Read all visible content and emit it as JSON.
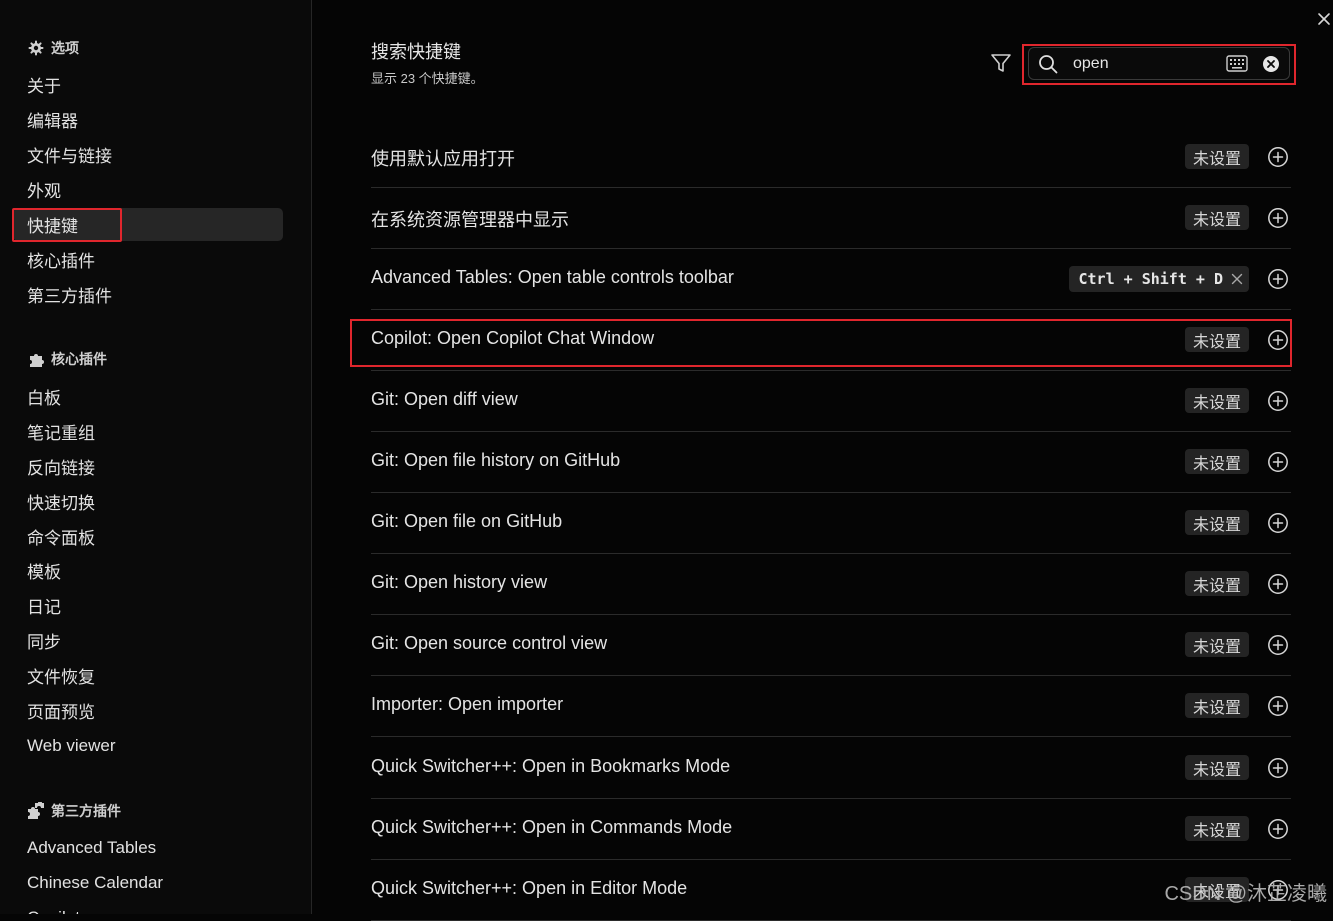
{
  "sidebar": {
    "options_header": "选项",
    "options_items": [
      "关于",
      "编辑器",
      "文件与链接",
      "外观",
      "快捷键",
      "核心插件",
      "第三方插件"
    ],
    "core_header": "核心插件",
    "core_items": [
      "白板",
      "笔记重组",
      "反向链接",
      "快速切换",
      "命令面板",
      "模板",
      "日记",
      "同步",
      "文件恢复",
      "页面预览",
      "Web viewer"
    ],
    "third_header": "第三方插件",
    "third_items": [
      "Advanced Tables",
      "Chinese Calendar",
      "Copilot"
    ]
  },
  "main": {
    "title": "搜索快捷键",
    "subtitle": "显示 23 个快捷键。",
    "search": {
      "value": "open"
    },
    "hotkeys": [
      {
        "name": "使用默认应用打开",
        "binding": "未设置"
      },
      {
        "name": "在系统资源管理器中显示",
        "binding": "未设置"
      },
      {
        "name": "Advanced Tables: Open table controls toolbar",
        "binding": "Ctrl + Shift + D"
      },
      {
        "name": "Copilot: Open Copilot Chat Window",
        "binding": "未设置"
      },
      {
        "name": "Git: Open diff view",
        "binding": "未设置"
      },
      {
        "name": "Git: Open file history on GitHub",
        "binding": "未设置"
      },
      {
        "name": "Git: Open file on GitHub",
        "binding": "未设置"
      },
      {
        "name": "Git: Open history view",
        "binding": "未设置"
      },
      {
        "name": "Git: Open source control view",
        "binding": "未设置"
      },
      {
        "name": "Importer: Open importer",
        "binding": "未设置"
      },
      {
        "name": "Quick Switcher++: Open in Bookmarks Mode",
        "binding": "未设置"
      },
      {
        "name": "Quick Switcher++: Open in Commands Mode",
        "binding": "未设置"
      },
      {
        "name": "Quick Switcher++: Open in Editor Mode",
        "binding": "未设置"
      }
    ]
  },
  "watermark": "CSDN @沐芷凌曦",
  "colors": {
    "highlight": "#e0262d",
    "background": "#050505",
    "badge": "#242424"
  },
  "icons": {
    "options": "gear-icon",
    "core": "puzzle-icon",
    "third": "puzzles-icon",
    "filter": "filter-icon",
    "search": "search-icon",
    "keyboard": "keyboard-icon",
    "clear": "circle-x-icon",
    "add": "circle-plus-icon",
    "remove": "x-icon",
    "close": "close-icon"
  }
}
